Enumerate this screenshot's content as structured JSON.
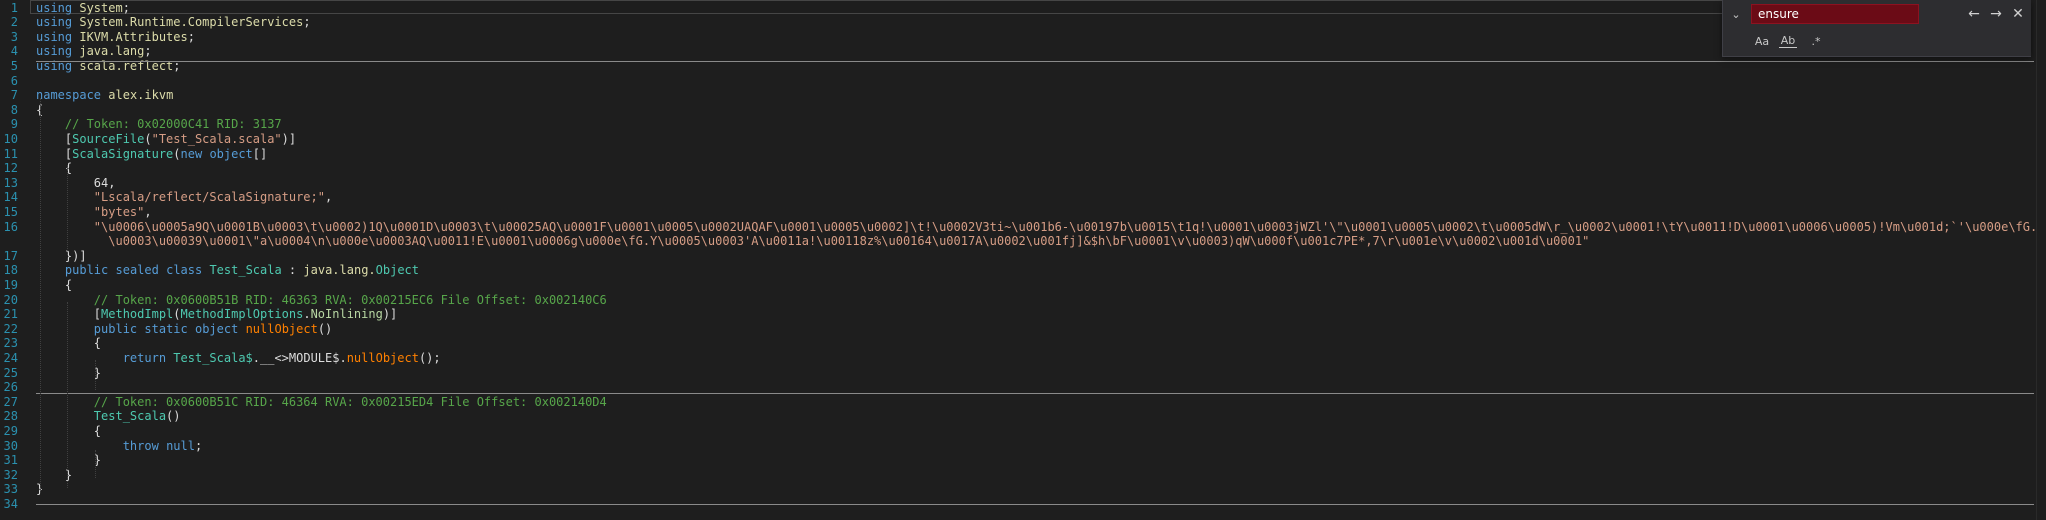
{
  "editor": {
    "lines": [
      {
        "n": "1",
        "tokens": [
          {
            "t": "using",
            "c": "kw"
          },
          {
            "t": " ",
            "c": "plain"
          },
          {
            "t": "System",
            "c": "ns"
          },
          {
            "t": ";",
            "c": "plain"
          }
        ]
      },
      {
        "n": "2",
        "tokens": [
          {
            "t": "using",
            "c": "kw"
          },
          {
            "t": " ",
            "c": "plain"
          },
          {
            "t": "System.Runtime.CompilerServices",
            "c": "ns"
          },
          {
            "t": ";",
            "c": "plain"
          }
        ]
      },
      {
        "n": "3",
        "tokens": [
          {
            "t": "using",
            "c": "kw"
          },
          {
            "t": " ",
            "c": "plain"
          },
          {
            "t": "IKVM.Attributes",
            "c": "ns"
          },
          {
            "t": ";",
            "c": "plain"
          }
        ]
      },
      {
        "n": "4",
        "tokens": [
          {
            "t": "using",
            "c": "kw"
          },
          {
            "t": " ",
            "c": "plain"
          },
          {
            "t": "java.lang",
            "c": "ns"
          },
          {
            "t": ";",
            "c": "plain"
          }
        ]
      },
      {
        "n": "5",
        "tokens": [
          {
            "t": "using",
            "c": "kw"
          },
          {
            "t": " ",
            "c": "plain"
          },
          {
            "t": "scala.reflect",
            "c": "ns"
          },
          {
            "t": ";",
            "c": "plain"
          }
        ]
      },
      {
        "n": "6",
        "tokens": []
      },
      {
        "n": "7",
        "tokens": [
          {
            "t": "namespace",
            "c": "kw"
          },
          {
            "t": " ",
            "c": "plain"
          },
          {
            "t": "alex.ikvm",
            "c": "ns"
          }
        ]
      },
      {
        "n": "8",
        "tokens": [
          {
            "t": "{",
            "c": "plain"
          }
        ]
      },
      {
        "n": "9",
        "tokens": [
          {
            "t": "    // Token: 0x02000C41 RID: 3137",
            "c": "comment"
          }
        ]
      },
      {
        "n": "10",
        "tokens": [
          {
            "t": "    [",
            "c": "plain"
          },
          {
            "t": "SourceFile",
            "c": "type"
          },
          {
            "t": "(",
            "c": "plain"
          },
          {
            "t": "\"Test_Scala.scala\"",
            "c": "str"
          },
          {
            "t": ")]",
            "c": "plain"
          }
        ]
      },
      {
        "n": "11",
        "tokens": [
          {
            "t": "    [",
            "c": "plain"
          },
          {
            "t": "ScalaSignature",
            "c": "type"
          },
          {
            "t": "(",
            "c": "plain"
          },
          {
            "t": "new",
            "c": "kw"
          },
          {
            "t": " ",
            "c": "plain"
          },
          {
            "t": "object",
            "c": "kw"
          },
          {
            "t": "[]",
            "c": "plain"
          }
        ]
      },
      {
        "n": "12",
        "tokens": [
          {
            "t": "    {",
            "c": "plain"
          }
        ]
      },
      {
        "n": "13",
        "tokens": [
          {
            "t": "        64,",
            "c": "plain"
          }
        ]
      },
      {
        "n": "14",
        "tokens": [
          {
            "t": "        ",
            "c": "plain"
          },
          {
            "t": "\"Lscala/reflect/ScalaSignature;\"",
            "c": "str"
          },
          {
            "t": ",",
            "c": "plain"
          }
        ]
      },
      {
        "n": "15",
        "tokens": [
          {
            "t": "        ",
            "c": "plain"
          },
          {
            "t": "\"bytes\"",
            "c": "str"
          },
          {
            "t": ",",
            "c": "plain"
          }
        ]
      },
      {
        "n": "16",
        "tokens": [
          {
            "t": "        ",
            "c": "plain"
          },
          {
            "t": "\"\\u0006\\u0005a9Q\\u0001B\\u0003\\t\\u0002)1Q\\u0001D\\u0003\\t\\u00025AQ\\u0001F\\u0001\\u0005\\u0002UAQAF\\u0001\\u0005\\u0002]\\t!\\u0002V3ti~\\u001b6-\\u00197b\\u0015\\t1q!\\u0001\\u0003jWZl'\\\"\\u0001\\u0005\\u0002\\t\\u0005dW\\r_\\u0002\\u0001!\\tY\\u0011!D\\u0001\\u0006\\u0005)!Vm\\u001d;`'\\u000e\\fG.Y\\n",
            "c": "str"
          }
        ]
      },
      {
        "n": "",
        "tokens": [
          {
            "t": "          \\u0003\\u00039\\u0001\\\"a\\u0004\\n\\u000e\\u0003AQ\\u0011!E\\u0001\\u0006g\\u000e\\fG.Y\\u0005\\u0003'A\\u0011a!\\u00118z%\\u00164\\u0017A\\u0002\\u001fj]&$h\\bF\\u0001\\v\\u0003)qW\\u000f\\u001c7PE*,7\\r\\u001e\\v\\u0002\\u001d\\u0001\"",
            "c": "str"
          }
        ]
      },
      {
        "n": "17",
        "tokens": [
          {
            "t": "    })]",
            "c": "plain"
          }
        ]
      },
      {
        "n": "18",
        "tokens": [
          {
            "t": "    ",
            "c": "plain"
          },
          {
            "t": "public",
            "c": "kw"
          },
          {
            "t": " ",
            "c": "plain"
          },
          {
            "t": "sealed",
            "c": "kw"
          },
          {
            "t": " ",
            "c": "plain"
          },
          {
            "t": "class",
            "c": "kw"
          },
          {
            "t": " ",
            "c": "plain"
          },
          {
            "t": "Test_Scala",
            "c": "type"
          },
          {
            "t": " : ",
            "c": "plain"
          },
          {
            "t": "java.lang.",
            "c": "ns"
          },
          {
            "t": "Object",
            "c": "type"
          }
        ]
      },
      {
        "n": "19",
        "tokens": [
          {
            "t": "    {",
            "c": "plain"
          }
        ]
      },
      {
        "n": "20",
        "tokens": [
          {
            "t": "        // Token: 0x0600B51B RID: 46363 RVA: 0x00215EC6 File Offset: 0x002140C6",
            "c": "comment"
          }
        ]
      },
      {
        "n": "21",
        "tokens": [
          {
            "t": "        [",
            "c": "plain"
          },
          {
            "t": "MethodImpl",
            "c": "type"
          },
          {
            "t": "(",
            "c": "plain"
          },
          {
            "t": "MethodImplOptions",
            "c": "type"
          },
          {
            "t": ".",
            "c": "plain"
          },
          {
            "t": "NoInlining",
            "c": "enum"
          },
          {
            "t": ")]",
            "c": "plain"
          }
        ]
      },
      {
        "n": "22",
        "tokens": [
          {
            "t": "        ",
            "c": "plain"
          },
          {
            "t": "public",
            "c": "kw"
          },
          {
            "t": " ",
            "c": "plain"
          },
          {
            "t": "static",
            "c": "kw"
          },
          {
            "t": " ",
            "c": "plain"
          },
          {
            "t": "object",
            "c": "kw"
          },
          {
            "t": " ",
            "c": "plain"
          },
          {
            "t": "nullObject",
            "c": "method"
          },
          {
            "t": "()",
            "c": "plain"
          }
        ]
      },
      {
        "n": "23",
        "tokens": [
          {
            "t": "        {",
            "c": "plain"
          }
        ]
      },
      {
        "n": "24",
        "tokens": [
          {
            "t": "            ",
            "c": "plain"
          },
          {
            "t": "return",
            "c": "kw"
          },
          {
            "t": " ",
            "c": "plain"
          },
          {
            "t": "Test_Scala$",
            "c": "type"
          },
          {
            "t": ".__<>MODULE$.",
            "c": "plain"
          },
          {
            "t": "nullObject",
            "c": "method"
          },
          {
            "t": "();",
            "c": "plain"
          }
        ]
      },
      {
        "n": "25",
        "tokens": [
          {
            "t": "        }",
            "c": "plain"
          }
        ]
      },
      {
        "n": "26",
        "tokens": []
      },
      {
        "n": "27",
        "tokens": [
          {
            "t": "        // Token: 0x0600B51C RID: 46364 RVA: 0x00215ED4 File Offset: 0x002140D4",
            "c": "comment"
          }
        ]
      },
      {
        "n": "28",
        "tokens": [
          {
            "t": "        ",
            "c": "plain"
          },
          {
            "t": "Test_Scala",
            "c": "type"
          },
          {
            "t": "()",
            "c": "plain"
          }
        ]
      },
      {
        "n": "29",
        "tokens": [
          {
            "t": "        {",
            "c": "plain"
          }
        ]
      },
      {
        "n": "30",
        "tokens": [
          {
            "t": "            ",
            "c": "plain"
          },
          {
            "t": "throw",
            "c": "kw"
          },
          {
            "t": " ",
            "c": "plain"
          },
          {
            "t": "null",
            "c": "kw"
          },
          {
            "t": ";",
            "c": "plain"
          }
        ]
      },
      {
        "n": "31",
        "tokens": [
          {
            "t": "        }",
            "c": "plain"
          }
        ]
      },
      {
        "n": "32",
        "tokens": [
          {
            "t": "    }",
            "c": "plain"
          }
        ]
      },
      {
        "n": "33",
        "tokens": [
          {
            "t": "}",
            "c": "plain"
          }
        ]
      },
      {
        "n": "34",
        "tokens": []
      }
    ]
  },
  "find": {
    "query": "ensure",
    "toggle_icon": "chevron-down-icon",
    "prev_icon": "arrow-left-icon",
    "next_icon": "arrow-right-icon",
    "close_icon": "close-icon",
    "match_case_label": "Aa",
    "whole_word_label": "Ab",
    "regex_label": ".*"
  },
  "colors": {
    "background": "#1e1e1e",
    "line_numbers": "#2b91af",
    "keyword": "#569cd6",
    "type": "#4ec9b0",
    "namespace": "#dcdcaa",
    "string": "#d69d85",
    "comment": "#57a64a",
    "method": "#ff8000",
    "find_input_no_match": "#6b0b16"
  }
}
